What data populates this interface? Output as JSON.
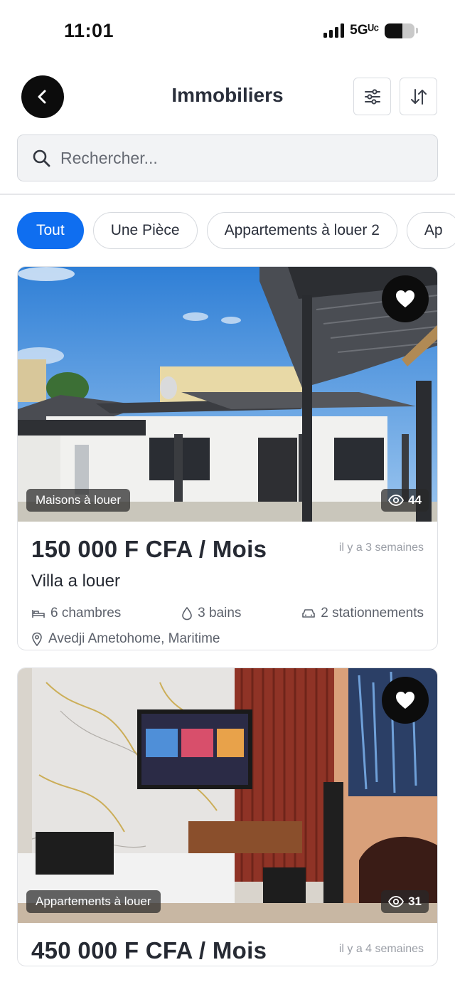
{
  "status_bar": {
    "time": "11:01",
    "network": "5Gᵁᶜ",
    "battery_level": 0.6
  },
  "header": {
    "title": "Immobiliers",
    "back_icon": "chevron-left-icon",
    "filter_icon": "sliders-icon",
    "sort_icon": "sort-arrows-icon"
  },
  "search": {
    "placeholder": "Rechercher..."
  },
  "categories": [
    {
      "label": "Tout",
      "active": true
    },
    {
      "label": "Une Pièce",
      "active": false
    },
    {
      "label": "Appartements à louer 2",
      "active": false
    },
    {
      "label": "Ap",
      "active": false
    }
  ],
  "listings": [
    {
      "category": "Maisons à louer",
      "views": "44",
      "price": "150 000 F CFA / Mois",
      "posted": "il y a 3 semaines",
      "title": "Villa a louer",
      "bedrooms": "6 chambres",
      "bathrooms": "3 bains",
      "parking": "2 stationnements",
      "location": "Avedji Ametohome, Maritime"
    },
    {
      "category": "Appartements à louer",
      "views": "31",
      "price": "450 000 F CFA / Mois",
      "posted": "il y a 4 semaines"
    }
  ],
  "colors": {
    "accent": "#0f6ef0",
    "dark": "#0c0c0c",
    "muted_text": "#5c616b"
  }
}
